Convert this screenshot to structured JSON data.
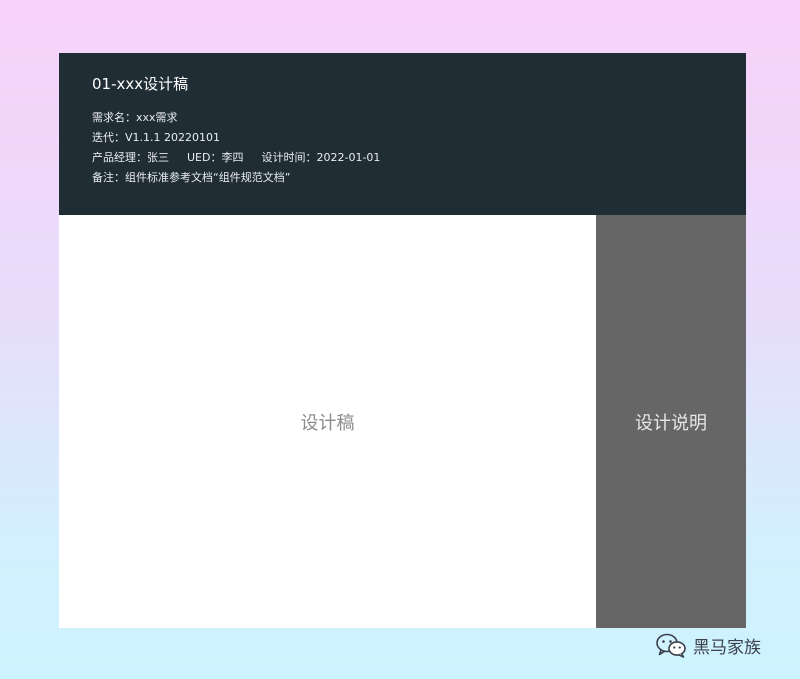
{
  "header": {
    "title": "01-xxx设计稿",
    "requirement": {
      "label": "需求名：",
      "value": "xxx需求"
    },
    "iteration": {
      "label": "迭代：",
      "value": "V1.1.1 20220101"
    },
    "product_manager": {
      "label": "产品经理：",
      "value": "张三"
    },
    "ued": {
      "label": "UED：",
      "value": "李四"
    },
    "design_time": {
      "label": "设计时间：",
      "value": "2022-01-01"
    },
    "remark": {
      "label": "备注：",
      "value": "组件标准参考文档“组件规范文档”"
    }
  },
  "design_area": {
    "label": "设计稿"
  },
  "notes_area": {
    "label": "设计说明"
  },
  "watermark": {
    "text": "黑马家族",
    "icon": "wechat-icon"
  },
  "colors": {
    "header_bg": "#202d35",
    "design_bg": "#ffffff",
    "notes_bg": "#666666"
  }
}
